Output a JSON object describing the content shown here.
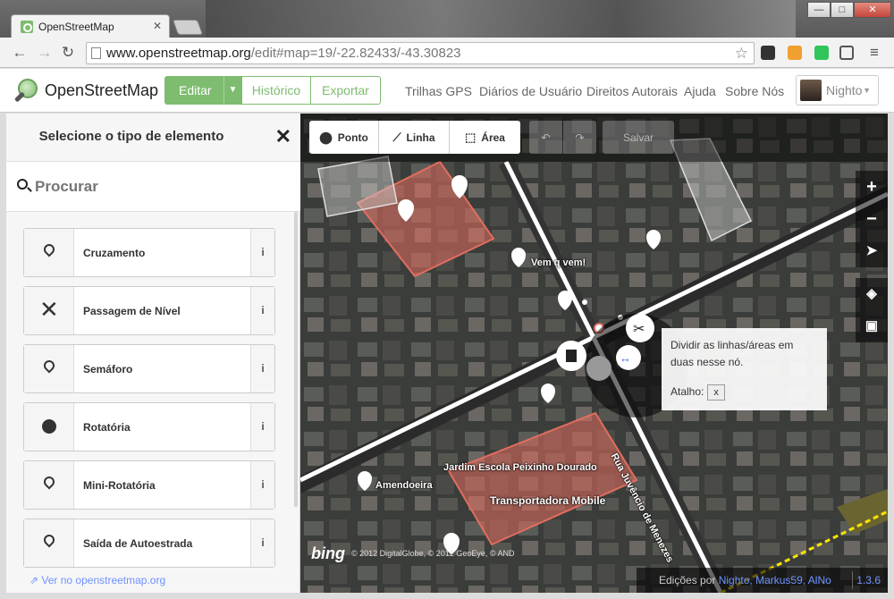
{
  "browser": {
    "tab_title": "OpenStreetMap",
    "tab_close": "✕",
    "url_host": "www.openstreetmap.org",
    "url_path": "/edit#map=19/-22.82433/-43.30823",
    "window_controls": {
      "minimize": "—",
      "maximize": "□",
      "close": "✕"
    }
  },
  "header": {
    "brand": "OpenStreetMap",
    "edit_label": "Editar",
    "history_label": "Histórico",
    "export_label": "Exportar",
    "nav": [
      "Trilhas GPS",
      "Diários de Usuário",
      "Direitos Autorais",
      "Ajuda",
      "Sobre Nós"
    ],
    "user_name": "Nighto"
  },
  "sidebar": {
    "title": "Selecione o tipo de elemento",
    "search_placeholder": "Procurar",
    "presets": [
      {
        "label": "Cruzamento",
        "icon": "pin-outline-icon"
      },
      {
        "label": "Passagem de Nível",
        "icon": "x-icon"
      },
      {
        "label": "Semáforo",
        "icon": "pin-outline-icon"
      },
      {
        "label": "Rotatória",
        "icon": "filled-circle-icon"
      },
      {
        "label": "Mini-Rotatória",
        "icon": "pin-outline-icon"
      },
      {
        "label": "Saída de Autoestrada",
        "icon": "pin-outline-icon"
      }
    ],
    "footer_link": "Ver no openstreetmap.org"
  },
  "map": {
    "modes": [
      "Ponto",
      "Linha",
      "Área"
    ],
    "save_label": "Salvar",
    "tooltip_text": "Dividir as linhas/áreas em duas nesse nó.",
    "tooltip_shortcut_label": "Atalho:",
    "tooltip_shortcut_key": "x",
    "labels": {
      "vem_q_vem": "Vem q vem!",
      "jardim": "Jardim Escola Peixinho Dourado",
      "amendoeira": "Amendoeira",
      "transportadora": "Transportadora Mobile",
      "rua": "Rua Juvêncio de Menezes"
    },
    "bing": "bing",
    "attribution": "© 2012 DigitalGlobe, © 2012 GeoEye, © AND",
    "footer_prefix": "Edições por",
    "footer_users": "Nighto, Markus59, AlNo",
    "version": "1.3.6"
  },
  "colors": {
    "accent": "#7ebc6f",
    "link": "#7092ff"
  }
}
